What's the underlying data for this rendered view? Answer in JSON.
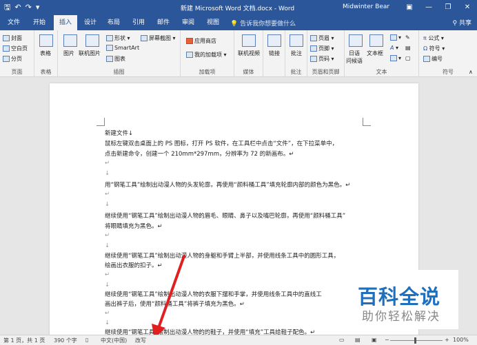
{
  "titlebar": {
    "save_icon": "save-icon",
    "undo_icon": "undo-icon",
    "redo_icon": "redo-icon",
    "customize_icon": "customize-qat-icon",
    "title": "新建 Microsoft Word 文档.docx - Word",
    "user": "Midwinter Bear",
    "ribbon_options_icon": "ribbon-display-icon",
    "minimize": "—",
    "restore": "❐",
    "close": "✕"
  },
  "tabs": [
    "文件",
    "开始",
    "插入",
    "设计",
    "布局",
    "引用",
    "邮件",
    "审阅",
    "视图"
  ],
  "active_tab": "插入",
  "tellme": "告诉我你想要做什么",
  "share": "共享",
  "ribbon": {
    "pages": {
      "items": [
        "封面",
        "空白页",
        "分页"
      ],
      "label": "页面"
    },
    "tables": {
      "item": "表格",
      "label": "表格"
    },
    "illustrations": {
      "picture": "图片",
      "online_picture": "联机图片",
      "shapes": "形状",
      "smartart": "SmartArt",
      "chart": "图表",
      "screenshot": "屏幕截图",
      "label": "插图"
    },
    "addins": {
      "store": "应用商店",
      "my_addins": "我的加载项",
      "label": "加载项"
    },
    "media": {
      "online_video": "联机视频",
      "label": "媒体"
    },
    "links": {
      "link": "链接"
    },
    "comments": {
      "comment": "批注",
      "label": "批注"
    },
    "header_footer": {
      "header": "页眉",
      "footer": "页脚",
      "page_number": "页码",
      "label": "页眉和页脚"
    },
    "text": {
      "date": "日语",
      "ime": "问候语",
      "textbox": "文本框",
      "label": "文本"
    },
    "symbols": {
      "equation": "公式",
      "symbol": "符号",
      "number": "编号",
      "label": "符号"
    }
  },
  "document": {
    "lines": [
      "新建文件↓",
      "鼠标左键双击桌面上的 PS 图标，打开 PS 软件，在工具栏中点击“文件”，在下拉菜单中，",
      "点击新建命令，创建一个 210mm*297mm，分辨率为 72 的新画布。↵",
      "↵",
      "↓",
      "用“钢笔工具”绘制出动漫人物的头发轮廓，再使用“颜料桶工具”填充轮廓内部的颜色为黑色。↵",
      "↵",
      "↓",
      "继续使用“钢笔工具”绘制出动漫人物的眉毛、眼睛、鼻子以及嘴巴轮廓，再使用“颜料桶工具”",
      "将眼睛填充为黑色。↵",
      "↵",
      "↓",
      "继续使用“钢笔工具”绘制出动漫人物的身躯和手臂上半部，并使用线条工具中的圆形工具，",
      "绘画出衣服的扣子。↵",
      "↵",
      "↓",
      "继续使用“钢笔工具”绘制出动漫人物的衣服下摆和手掌，并使用线条工具中的直线工",
      "画出裤子后，使用“颜料桶工具”将裤子填充为黑色。↵",
      "↵",
      "↓",
      "继续使用“钢笔工具”绘制出动漫人物的的鞋子，并使用“填充”工具给鞋子配色。↵"
    ]
  },
  "watermark": {
    "main": "百科全说",
    "sub": "助你轻松解决"
  },
  "status": {
    "page": "第 1 页，共 1 页",
    "words": "390 个字",
    "proofing_icon": "proofing-icon",
    "language": "中文(中国)",
    "mode": "改写",
    "zoom": "100%",
    "zoom_value": 1.0
  },
  "colors": {
    "accent": "#2b579a",
    "arrow": "#e02020",
    "watermark_blue": "#1e6fbd"
  }
}
